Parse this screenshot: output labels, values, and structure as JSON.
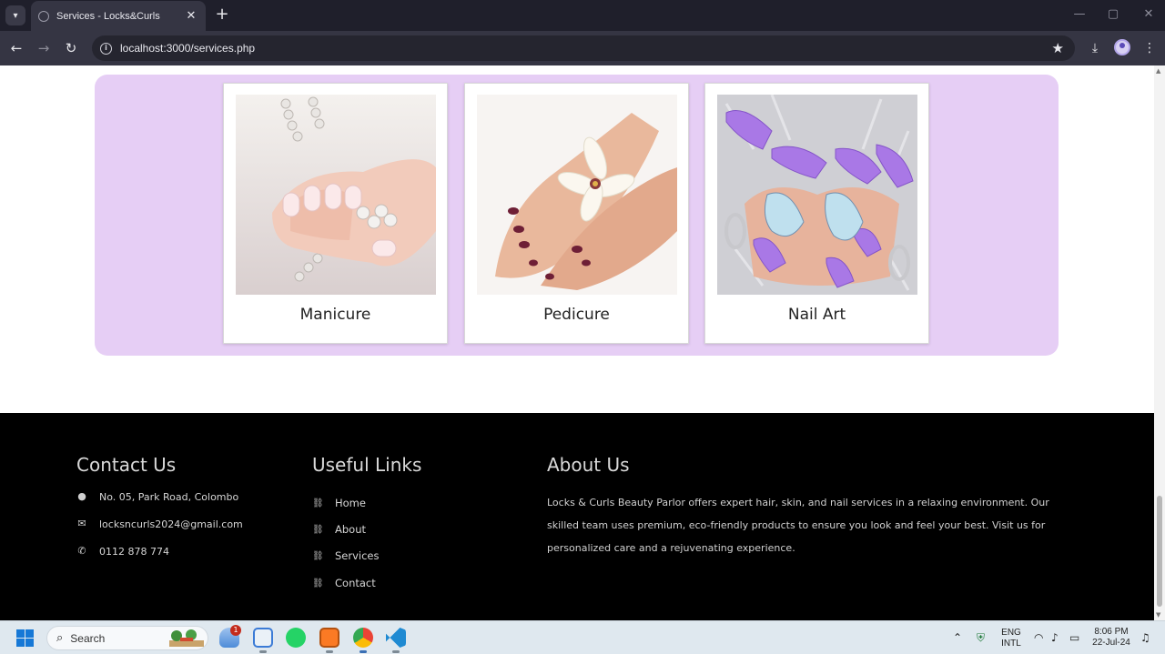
{
  "browser": {
    "tab_title": "Services - Locks&Curls",
    "url": "localhost:3000/services.php",
    "new_tab": "+",
    "close": "✕",
    "minimize": "—",
    "maximize": "▢",
    "window_close": "✕"
  },
  "services": [
    {
      "label": "Manicure"
    },
    {
      "label": "Pedicure"
    },
    {
      "label": "Nail Art"
    }
  ],
  "footer": {
    "contact": {
      "heading": "Contact Us",
      "address": "No. 05, Park Road, Colombo",
      "email": "locksncurls2024@gmail.com",
      "phone": "0112 878 774"
    },
    "links": {
      "heading": "Useful Links",
      "items": [
        "Home",
        "About",
        "Services",
        "Contact"
      ]
    },
    "about": {
      "heading": "About Us",
      "text": "Locks & Curls Beauty Parlor offers expert hair, skin, and nail services in a relaxing environment. Our skilled team uses premium, eco-friendly products to ensure you look and feel your best. Visit us for personalized care and a rejuvenating experience."
    }
  },
  "taskbar": {
    "search_label": "Search",
    "weather_badge": "1",
    "lang_line1": "ENG",
    "lang_line2": "INTL",
    "time": "8:06 PM",
    "date": "22-Jul-24"
  },
  "colors": {
    "panel_bg": "#e6cef5",
    "footer_bg": "#000000",
    "chrome_dark": "#1f1f2b",
    "chrome_toolbar": "#353543"
  }
}
